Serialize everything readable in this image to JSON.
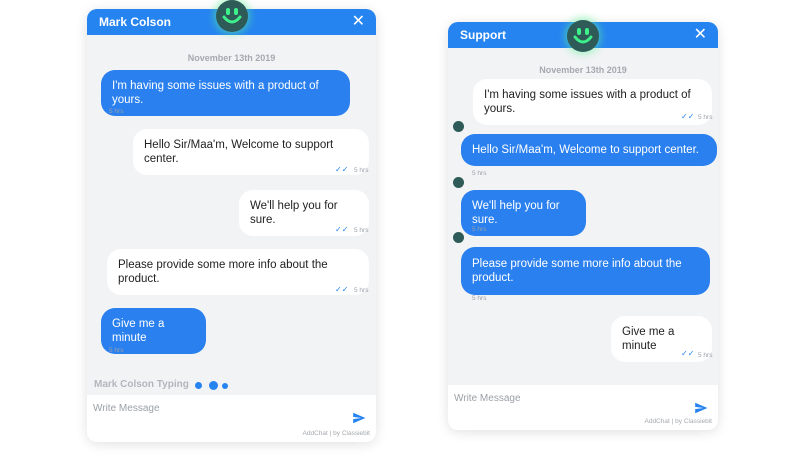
{
  "left": {
    "header_title": "Mark Colson",
    "close_glyph": "✕",
    "date": "November 13th 2019",
    "messages": [
      {
        "text": "I'm having some issues with a product of yours.",
        "time": "5 hrs"
      },
      {
        "text": "Hello Sir/Maa'm, Welcome to support center.",
        "time": "5 hrs"
      },
      {
        "text": "We'll help you for sure.",
        "time": "5 hrs"
      },
      {
        "text": "Please provide some more info about the product.",
        "time": "5 hrs"
      },
      {
        "text": "Give me a minute",
        "time": "5 hrs"
      }
    ],
    "typing_text": "Mark Colson Typing",
    "input_placeholder": "Write Message",
    "powered_by": "AddChat | by Classiebit"
  },
  "right": {
    "header_title": "Support",
    "close_glyph": "✕",
    "date": "November 13th 2019",
    "messages": [
      {
        "text": "I'm having some issues with a product of yours.",
        "time": "5 hrs"
      },
      {
        "text": "Hello Sir/Maa'm, Welcome to support center.",
        "time": "5 hrs"
      },
      {
        "text": "We'll help you for sure.",
        "time": "5 hrs"
      },
      {
        "text": "Please provide some more info about the product.",
        "time": "5 hrs"
      },
      {
        "text": "Give me a minute",
        "time": "5 hrs"
      }
    ],
    "input_placeholder": "Write Message",
    "powered_by": "AddChat | by Classiebit"
  },
  "colors": {
    "accent": "#2684f0",
    "bubble_blue": "#2a80ee",
    "bubble_white": "#ffffff",
    "panel_bg": "#f2f3f5",
    "avatar": "#2e5a57",
    "avatar_glow": "#5af096"
  },
  "icons": {
    "avatar": "smiley-face-icon",
    "close": "close-icon",
    "send": "send-icon",
    "read": "double-check-icon"
  }
}
